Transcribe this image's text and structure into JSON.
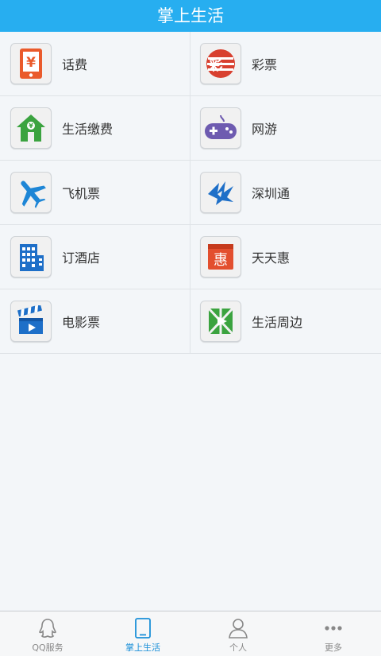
{
  "header": {
    "title": "掌上生活"
  },
  "items": [
    {
      "label": "话费",
      "icon": "phone-bill-icon"
    },
    {
      "label": "彩票",
      "icon": "lottery-icon"
    },
    {
      "label": "生活缴费",
      "icon": "utilities-home-icon"
    },
    {
      "label": "网游",
      "icon": "gamepad-icon"
    },
    {
      "label": "飞机票",
      "icon": "airplane-icon"
    },
    {
      "label": "深圳通",
      "icon": "shenzhen-tong-icon"
    },
    {
      "label": "订酒店",
      "icon": "hotel-icon"
    },
    {
      "label": "天天惠",
      "icon": "daily-deal-icon"
    },
    {
      "label": "电影票",
      "icon": "clapperboard-icon"
    },
    {
      "label": "生活周边",
      "icon": "nearby-life-icon"
    }
  ],
  "tabbar": {
    "tabs": [
      {
        "label": "QQ服务",
        "icon": "qq-penguin-icon"
      },
      {
        "label": "掌上生活",
        "icon": "tablet-icon"
      },
      {
        "label": "个人",
        "icon": "person-icon"
      },
      {
        "label": "更多",
        "icon": "more-dots-icon"
      }
    ],
    "active": "掌上生活"
  },
  "colors": {
    "header": "#27aef0",
    "active_tab": "#1a8fd8",
    "background": "#f3f6f9"
  }
}
